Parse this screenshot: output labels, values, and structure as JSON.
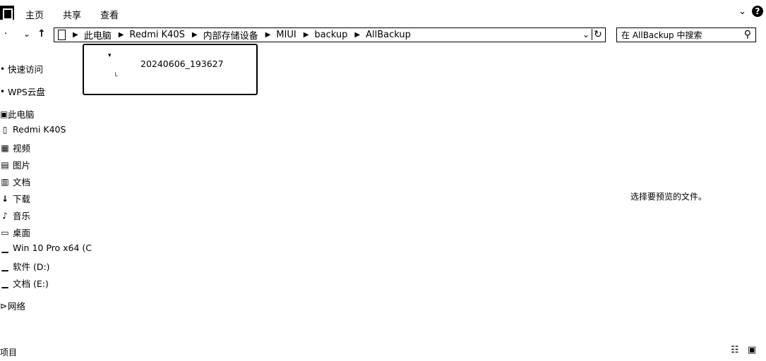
{
  "ribbon": {
    "tabs": [
      "主页",
      "共享",
      "查看"
    ]
  },
  "nav": {
    "back": "←",
    "dropdown": "⌄",
    "up": "↑"
  },
  "address": {
    "crumbs": [
      "此电脑",
      "Redmi K40S",
      "内部存储设备",
      "MIUI",
      "backup",
      "AllBackup"
    ]
  },
  "search": {
    "placeholder": "在 AllBackup 中搜索"
  },
  "sidebar": {
    "items": [
      {
        "label": "快速访问",
        "icon": "star-icon"
      },
      {
        "label": "WPS云盘",
        "icon": "cloud-icon"
      },
      {
        "label": "此电脑",
        "icon": "computer-icon"
      },
      {
        "label": "Redmi K40S",
        "icon": "phone-icon"
      },
      {
        "label": "视频",
        "icon": "video-icon"
      },
      {
        "label": "图片",
        "icon": "picture-icon"
      },
      {
        "label": "文档",
        "icon": "document-icon"
      },
      {
        "label": "下载",
        "icon": "download-icon"
      },
      {
        "label": "音乐",
        "icon": "music-icon"
      },
      {
        "label": "桌面",
        "icon": "desktop-icon"
      },
      {
        "label": "Win 10 Pro x64 (C",
        "icon": "drive-icon"
      },
      {
        "label": "软件 (D:)",
        "icon": "drive-icon"
      },
      {
        "label": "文档 (E:)",
        "icon": "drive-icon"
      },
      {
        "label": "网络",
        "icon": "network-icon"
      }
    ]
  },
  "files": [
    {
      "name": "20240606_193627"
    }
  ],
  "preview": {
    "message": "选择要预览的文件。"
  },
  "status": {
    "text": "项目"
  }
}
